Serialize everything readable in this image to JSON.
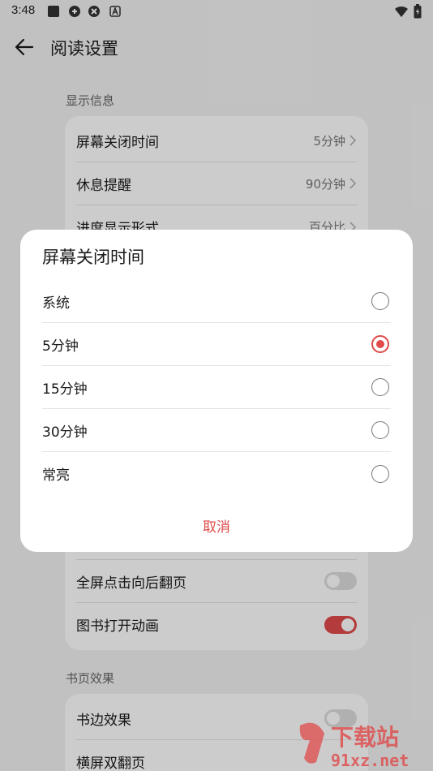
{
  "status": {
    "time": "3:48"
  },
  "header": {
    "title": "阅读设置"
  },
  "sections": {
    "display": {
      "label": "显示信息",
      "rows": [
        {
          "label": "屏幕关闭时间",
          "value": "5分钟"
        },
        {
          "label": "休息提醒",
          "value": "90分钟"
        },
        {
          "label": "进度显示形式",
          "value": "百分比"
        }
      ]
    },
    "toggles": [
      {
        "label": "全屏点击向后翻页",
        "on": false
      },
      {
        "label": "图书打开动画",
        "on": true
      }
    ],
    "page_effect": {
      "label": "书页效果",
      "rows": [
        {
          "label": "书边效果"
        },
        {
          "label": "横屏双翻页"
        }
      ]
    }
  },
  "dialog": {
    "title": "屏幕关闭时间",
    "options": [
      "系统",
      "5分钟",
      "15分钟",
      "30分钟",
      "常亮"
    ],
    "selected": "5分钟",
    "cancel_label": "取消"
  },
  "watermark": {
    "text": "下载站",
    "url_text": "91xz.net"
  },
  "colors": {
    "accent": "#e04a4a",
    "background": "#f2f2f2",
    "card": "#ffffff"
  }
}
